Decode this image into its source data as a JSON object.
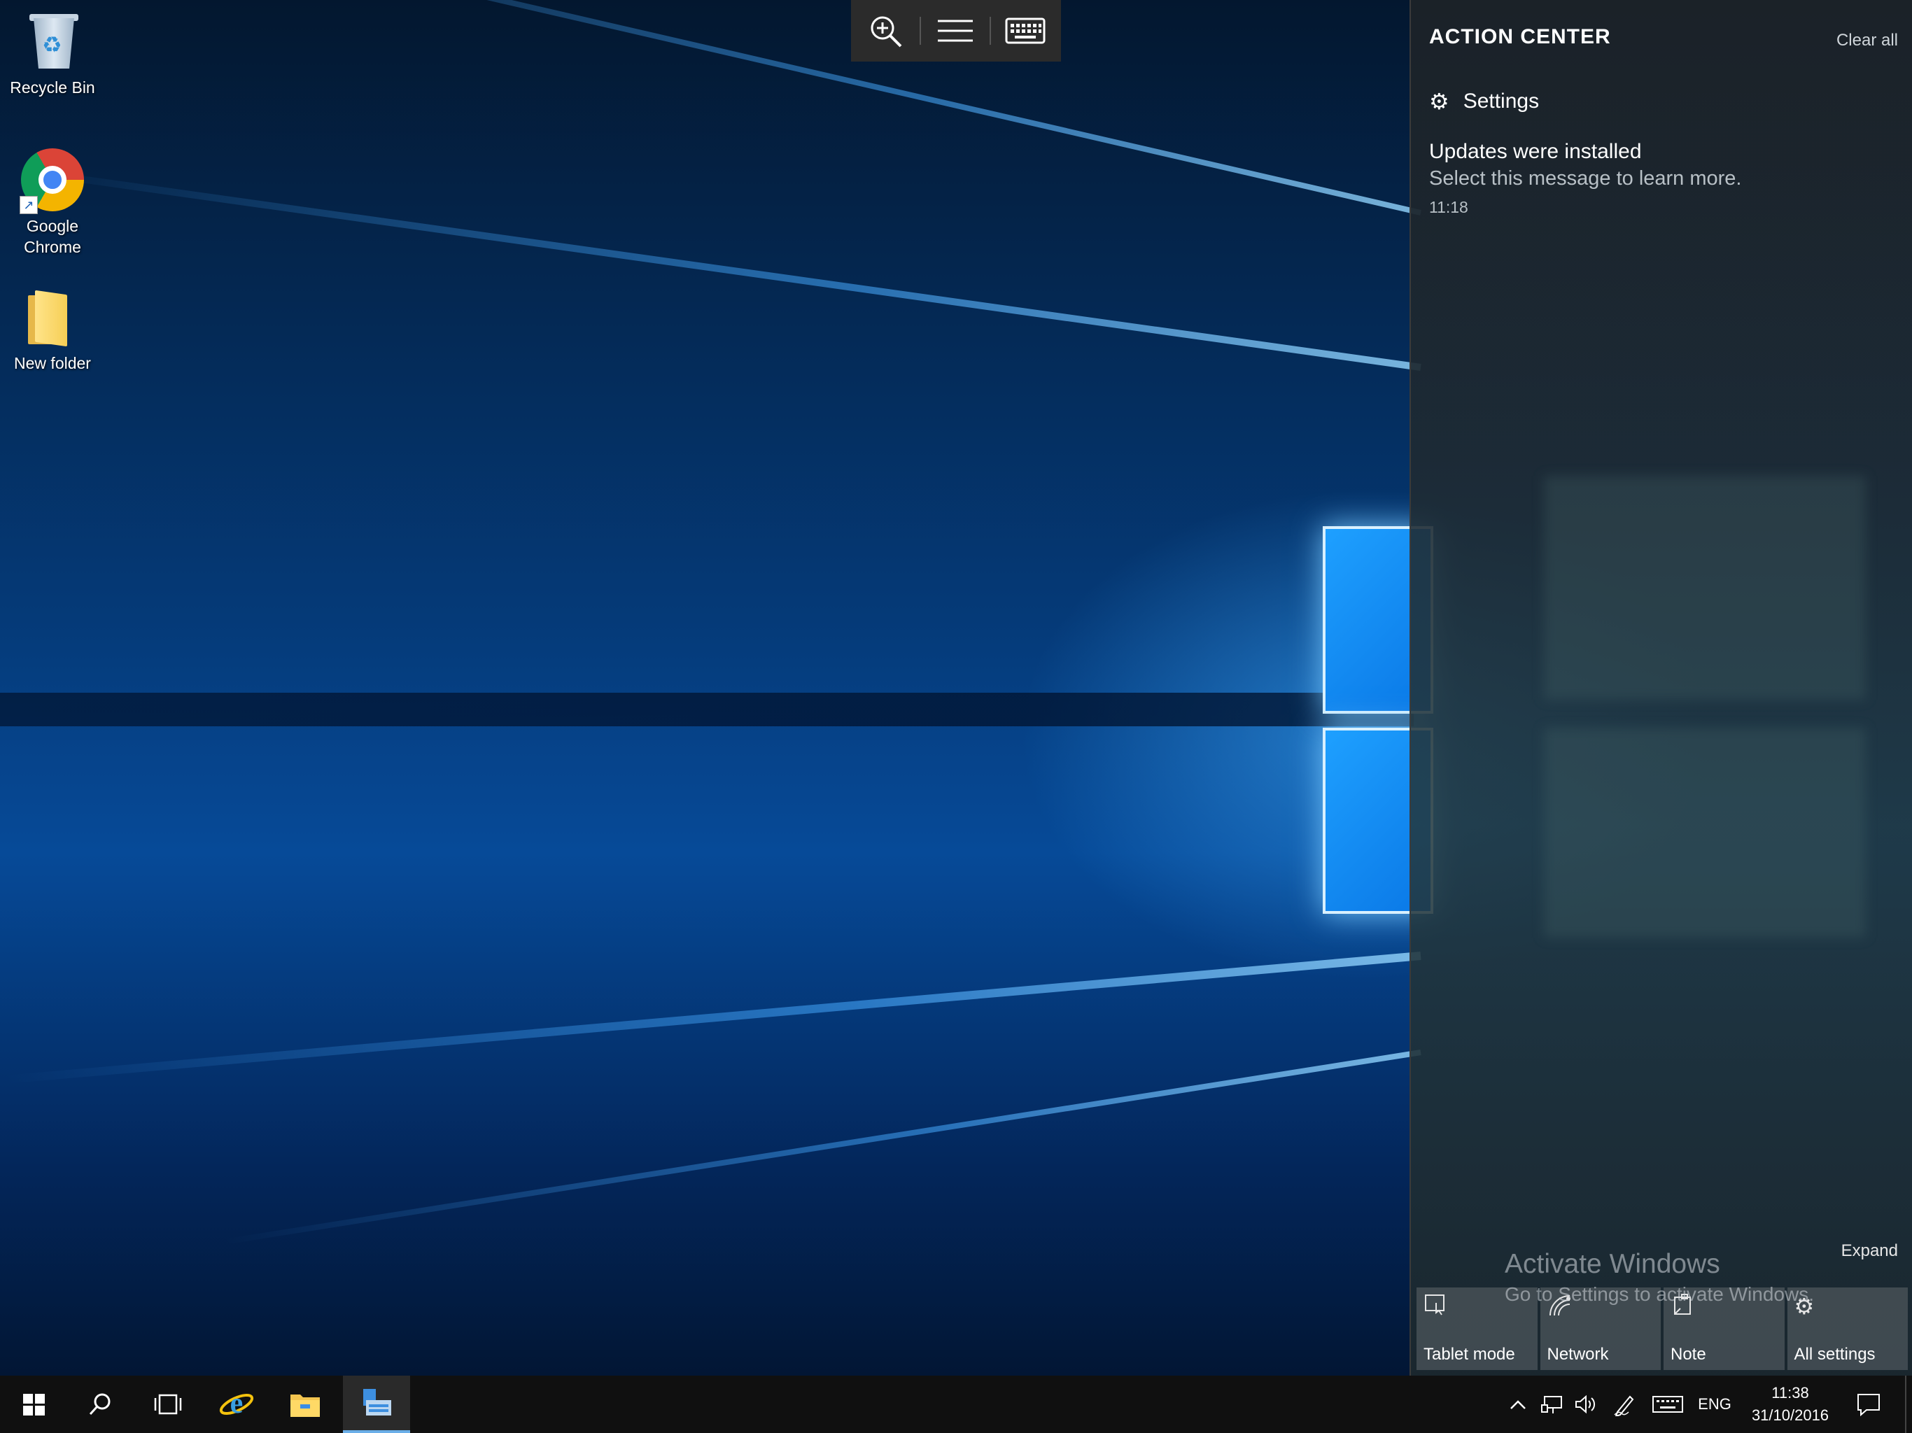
{
  "desktop": {
    "icons": [
      {
        "label": "Recycle Bin"
      },
      {
        "label": "Google Chrome"
      },
      {
        "label": "New folder"
      }
    ]
  },
  "top_toolbar": {
    "icons": [
      "zoom-in-icon",
      "menu-icon",
      "keyboard-icon"
    ]
  },
  "action_center": {
    "title": "ACTION CENTER",
    "clear_all": "Clear all",
    "group_label": "Settings",
    "notification": {
      "title": "Updates were installed",
      "body": "Select this message to learn more.",
      "time": "11:18"
    },
    "expand": "Expand",
    "quick_actions": [
      {
        "label": "Tablet mode",
        "icon": "tablet-mode-icon"
      },
      {
        "label": "Network",
        "icon": "network-icon"
      },
      {
        "label": "Note",
        "icon": "note-icon"
      },
      {
        "label": "All settings",
        "icon": "settings-gear-icon"
      }
    ]
  },
  "watermark": {
    "title": "Activate Windows",
    "body": "Go to Settings to activate Windows."
  },
  "taskbar": {
    "tray": {
      "language": "ENG",
      "time": "11:38",
      "date": "31/10/2016"
    }
  }
}
